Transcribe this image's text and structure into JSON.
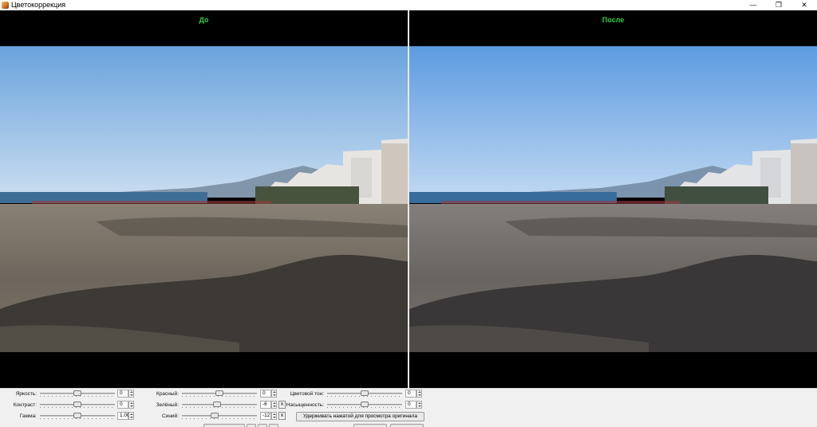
{
  "window": {
    "title": "Цветокоррекция",
    "minimize_glyph": "—",
    "maximize_glyph": "❐",
    "close_glyph": "✕"
  },
  "panes": {
    "before_label": "До",
    "after_label": "После"
  },
  "colors": {
    "label_green": "#2ecc40",
    "pane_background": "#000000",
    "toolbar_background": "#f0f0f0"
  },
  "adjustments": {
    "brightness": {
      "label": "Яркость:",
      "value": "0",
      "level": 0.5
    },
    "contrast": {
      "label": "Контраст:",
      "value": "0",
      "level": 0.5
    },
    "gamma": {
      "label": "Гамма:",
      "value": "1.00",
      "level": 0.5
    },
    "red": {
      "label": "Красный:",
      "value": "0",
      "level": 0.5
    },
    "green": {
      "label": "Зелёный:",
      "value": "-6",
      "level": 0.47
    },
    "blue": {
      "label": "Синий:",
      "value": "-12",
      "level": 0.44
    },
    "hue": {
      "label": "Цветовой тон:",
      "value": "0",
      "level": 0.5
    },
    "saturation": {
      "label": "Насыщенность:",
      "value": "0",
      "level": 0.5
    }
  },
  "reset_glyph": "x",
  "hold_original_button": "Удерживать нажатой для просмотра оригинала"
}
